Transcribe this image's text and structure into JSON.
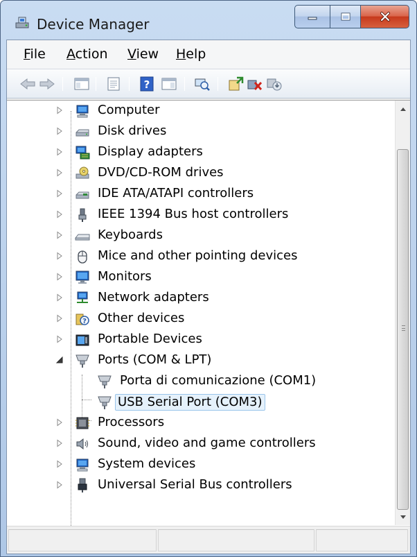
{
  "window": {
    "title": "Device Manager",
    "icon": "device-manager-icon"
  },
  "menu": [
    {
      "label_acc": "F",
      "label_rest": "ile"
    },
    {
      "label_acc": "A",
      "label_rest": "ction"
    },
    {
      "label_acc": "V",
      "label_rest": "iew"
    },
    {
      "label_acc": "H",
      "label_rest": "elp"
    }
  ],
  "toolbar": [
    "back-arrow-icon",
    "forward-arrow-icon",
    "show-hide-console-tree-icon",
    "properties-icon",
    "help-icon",
    "action-pane-icon",
    "scan-hardware-icon",
    "update-driver-icon",
    "uninstall-device-icon",
    "disable-device-icon"
  ],
  "tree": {
    "items": [
      {
        "label": "Computer",
        "icon": "computer-icon",
        "expanded": false
      },
      {
        "label": "Disk drives",
        "icon": "disk-drive-icon",
        "expanded": false
      },
      {
        "label": "Display adapters",
        "icon": "display-adapter-icon",
        "expanded": false
      },
      {
        "label": "DVD/CD-ROM drives",
        "icon": "dvd-drive-icon",
        "expanded": false
      },
      {
        "label": "IDE ATA/ATAPI controllers",
        "icon": "ide-controller-icon",
        "expanded": false
      },
      {
        "label": "IEEE 1394 Bus host controllers",
        "icon": "firewire-icon",
        "expanded": false
      },
      {
        "label": "Keyboards",
        "icon": "keyboard-icon",
        "expanded": false
      },
      {
        "label": "Mice and other pointing devices",
        "icon": "mouse-icon",
        "expanded": false
      },
      {
        "label": "Monitors",
        "icon": "monitor-icon",
        "expanded": false
      },
      {
        "label": "Network adapters",
        "icon": "network-adapter-icon",
        "expanded": false
      },
      {
        "label": "Other devices",
        "icon": "unknown-device-icon",
        "expanded": false
      },
      {
        "label": "Portable Devices",
        "icon": "portable-device-icon",
        "expanded": false
      },
      {
        "label": "Ports (COM & LPT)",
        "icon": "port-icon",
        "expanded": true
      },
      {
        "label": "Processors",
        "icon": "processor-icon",
        "expanded": false
      },
      {
        "label": "Sound, video and game controllers",
        "icon": "sound-icon",
        "expanded": false
      },
      {
        "label": "System devices",
        "icon": "system-device-icon",
        "expanded": false
      },
      {
        "label": "Universal Serial Bus controllers",
        "icon": "usb-icon",
        "expanded": false
      }
    ],
    "ports_children": [
      {
        "label": "Porta di comunicazione (COM1)",
        "icon": "port-icon",
        "selected": false
      },
      {
        "label": "USB Serial Port (COM3)",
        "icon": "port-icon",
        "selected": true
      }
    ]
  }
}
